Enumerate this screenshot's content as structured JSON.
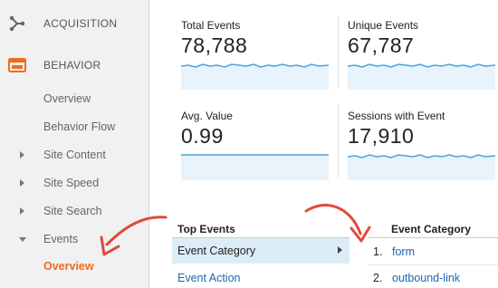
{
  "sidebar": {
    "sections": [
      {
        "label": "ACQUISITION",
        "icon": "acquisition-icon"
      },
      {
        "label": "BEHAVIOR",
        "icon": "behavior-icon"
      }
    ],
    "items": [
      {
        "label": "Overview"
      },
      {
        "label": "Behavior Flow"
      },
      {
        "label": "Site Content"
      },
      {
        "label": "Site Speed"
      },
      {
        "label": "Site Search"
      },
      {
        "label": "Events"
      },
      {
        "label": "Overview"
      }
    ]
  },
  "metrics": [
    {
      "title": "Total Events",
      "value": "78,788"
    },
    {
      "title": "Unique Events",
      "value": "67,787"
    },
    {
      "title": "Avg. Value",
      "value": "0.99"
    },
    {
      "title": "Sessions with Event",
      "value": "17,910"
    }
  ],
  "top_events": {
    "header": "Top Events",
    "items": [
      {
        "label": "Event Category"
      },
      {
        "label": "Event Action"
      }
    ]
  },
  "event_category": {
    "header": "Event Category",
    "rows": [
      {
        "num": "1.",
        "label": "form"
      },
      {
        "num": "2.",
        "label": "outbound-link"
      }
    ]
  },
  "colors": {
    "accent_orange": "#f26a1b",
    "link_blue": "#1a66b3",
    "selected_row": "#dcedf7",
    "sparkline": "#4aa3df",
    "annotation_red": "#e04a3a"
  }
}
